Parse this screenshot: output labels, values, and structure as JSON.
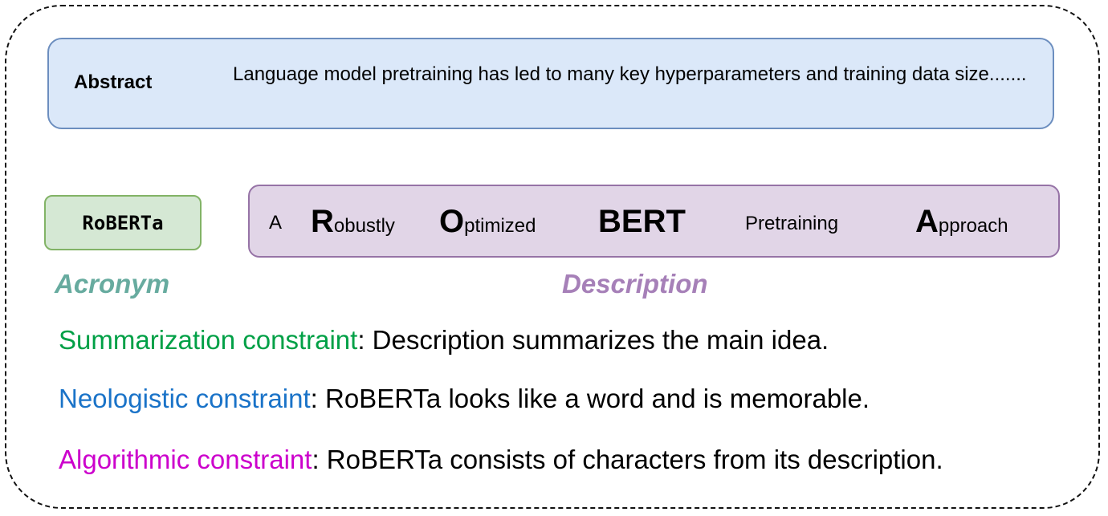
{
  "abstract": {
    "label": "Abstract",
    "text": "Language model pretraining has led to many key hyperparameters and training data size......."
  },
  "acronym_box": {
    "text": "RoBERTa"
  },
  "description_words": [
    {
      "cap": "A",
      "rest": ""
    },
    {
      "cap": "R",
      "rest": "obustly"
    },
    {
      "cap": "O",
      "rest": "ptimized"
    },
    {
      "cap": "BERT",
      "rest": ""
    },
    {
      "cap": "",
      "rest": "Pretraining"
    },
    {
      "cap": "A",
      "rest": "pproach"
    }
  ],
  "captions": {
    "acronym": "Acronym",
    "description": "Description"
  },
  "constraints": [
    {
      "name": "Summarization constraint",
      "text": ": Description summarizes the main idea.",
      "color": "#00a046"
    },
    {
      "name": "Neologistic constraint",
      "text": ": RoBERTa looks like a word and is memorable.",
      "color": "#1a73c8"
    },
    {
      "name": "Algorithmic constraint",
      "text": ": RoBERTa consists of characters from its description.",
      "color": "#cc00cc"
    }
  ]
}
